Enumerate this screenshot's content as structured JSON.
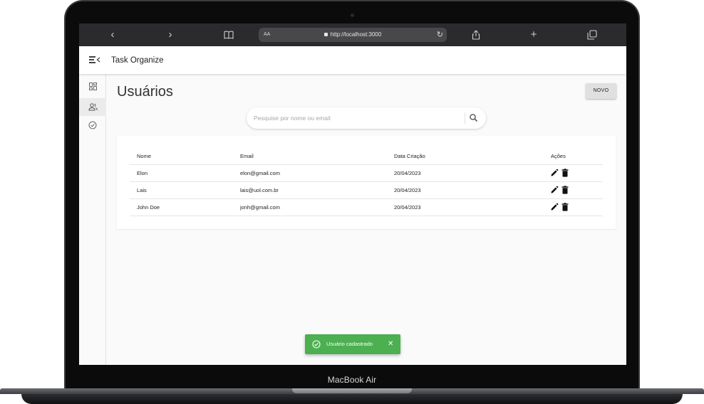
{
  "device": {
    "label": "MacBook Air"
  },
  "browser": {
    "text_size_label": "AA",
    "url": "http://localhost:3000"
  },
  "app": {
    "title": "Task Organize"
  },
  "sidebar": {
    "items": [
      {
        "icon": "dashboard-icon"
      },
      {
        "icon": "users-icon",
        "active": true
      },
      {
        "icon": "check-circle-icon"
      }
    ]
  },
  "page": {
    "title": "Usuários",
    "new_button_label": "NOVO"
  },
  "search": {
    "placeholder": "Pesquise por nome ou email"
  },
  "table": {
    "headers": {
      "name": "Nome",
      "email": "Email",
      "created": "Data Criação",
      "actions": "Ações"
    },
    "rows": [
      {
        "name": "Elon",
        "email": "elon@gmail.com",
        "created": "20/04/2023"
      },
      {
        "name": "Lais",
        "email": "lais@uol.com.br",
        "created": "20/04/2023"
      },
      {
        "name": "John Doe",
        "email": "jonh@gmail.com",
        "created": "20/04/2023"
      }
    ]
  },
  "snackbar": {
    "message": "Usuário cadastrado",
    "color": "#4caf50"
  }
}
